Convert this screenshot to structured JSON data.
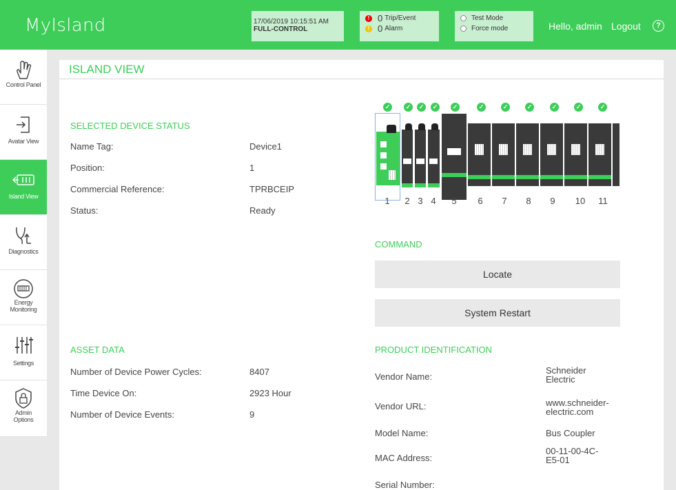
{
  "header": {
    "app_title": "MyIsland",
    "datetime": "17/06/2019 10:15:51 AM",
    "control_mode": "FULL-CONTROL",
    "trip_event_count": "0",
    "trip_event_label": "Trip/Event",
    "alarm_count": "0",
    "alarm_label": "Alarm",
    "test_mode_label": "Test Mode",
    "force_mode_label": "Force mode",
    "greeting": "Hello, admin",
    "logout_label": "Logout",
    "help_icon": "?"
  },
  "sidebar": {
    "items": [
      {
        "label": "Control Panel",
        "icon": "hand-icon"
      },
      {
        "label": "Avatar View",
        "icon": "login-icon"
      },
      {
        "label": "Island View",
        "icon": "island-icon"
      },
      {
        "label": "Diagnostics",
        "icon": "stethoscope-icon"
      },
      {
        "label": "Energy",
        "label2": "Monitoring",
        "icon": "meter-icon"
      },
      {
        "label": "Settings",
        "icon": "sliders-icon"
      },
      {
        "label": "Admin",
        "label2": "Options",
        "icon": "lock-shield-icon"
      }
    ]
  },
  "main": {
    "title": "ISLAND VIEW",
    "selected_status": {
      "title": "SELECTED DEVICE STATUS",
      "rows": [
        {
          "label": "Name Tag:",
          "value": "Device1"
        },
        {
          "label": "Position:",
          "value": "1"
        },
        {
          "label": "Commercial Reference:",
          "value": "TPRBCEIP"
        },
        {
          "label": "Status:",
          "value": "Ready"
        }
      ]
    },
    "asset": {
      "title": "ASSET DATA",
      "rows": [
        {
          "label": "Number of Device Power Cycles:",
          "value": "8407"
        },
        {
          "label": "Time Device On:",
          "value": "2923 Hour"
        },
        {
          "label": "Number of Device Events:",
          "value": "9"
        }
      ]
    },
    "command": {
      "title": "COMMAND",
      "locate_label": "Locate",
      "restart_label": "System Restart"
    },
    "product": {
      "title": "PRODUCT IDENTIFICATION",
      "rows": [
        {
          "label": "Vendor Name:",
          "value1": "Schneider",
          "value2": "Electric"
        },
        {
          "label": "Vendor URL:",
          "value1": "www.schneider-",
          "value2": "electric.com"
        },
        {
          "label": "Model Name:",
          "value1": "Bus Coupler",
          "value2": ""
        },
        {
          "label": "MAC Address:",
          "value1": "00-11-00-4C-",
          "value2": "E5-01"
        },
        {
          "label": "Serial Number:",
          "value1": "",
          "value2": ""
        }
      ]
    },
    "devices": {
      "numbers": [
        "1",
        "2",
        "3",
        "4",
        "5",
        "6",
        "7",
        "8",
        "9",
        "10",
        "11"
      ],
      "status": "ok",
      "colors": {
        "accent": "#3dcd58",
        "body": "#3a3a3a"
      }
    }
  }
}
